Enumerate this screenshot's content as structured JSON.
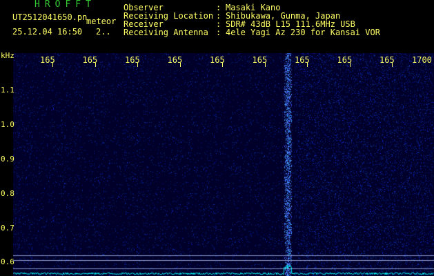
{
  "header": {
    "app_title": "HROFFT",
    "filename": "UT2512041650.pn",
    "meteor_label": "meteor",
    "timestamp": "25.12.04 16:50",
    "count": "2..",
    "info": [
      {
        "label": "Observer",
        "value": "Masaki Kano"
      },
      {
        "label": "Receiving Location",
        "value": "Shibukawa, Gunma, Japan"
      },
      {
        "label": "Receiver",
        "value": "SDR# 43dB L15 111.6MHz USB"
      },
      {
        "label": "Receiving Antenna",
        "value": "4ele Yagi Az 230 for Kansai VOR"
      }
    ],
    "separator": ":"
  },
  "colors": {
    "title": "#33cc33",
    "text": "#ffff66",
    "background": "#000000",
    "plot_bg": "#00002a",
    "signal": "#3355ff",
    "baseline": "#00ffff"
  },
  "chart_data": {
    "type": "heatmap",
    "y_unit": "kHz",
    "x_ticks": [
      "165",
      "165",
      "165",
      "165",
      "165",
      "165",
      "165",
      "165",
      "165",
      "1700"
    ],
    "y_ticks": [
      "1.1",
      "1.0",
      "0.9",
      "0.8",
      "0.7",
      "0.6"
    ],
    "signal_x_tick_index": 6
  }
}
